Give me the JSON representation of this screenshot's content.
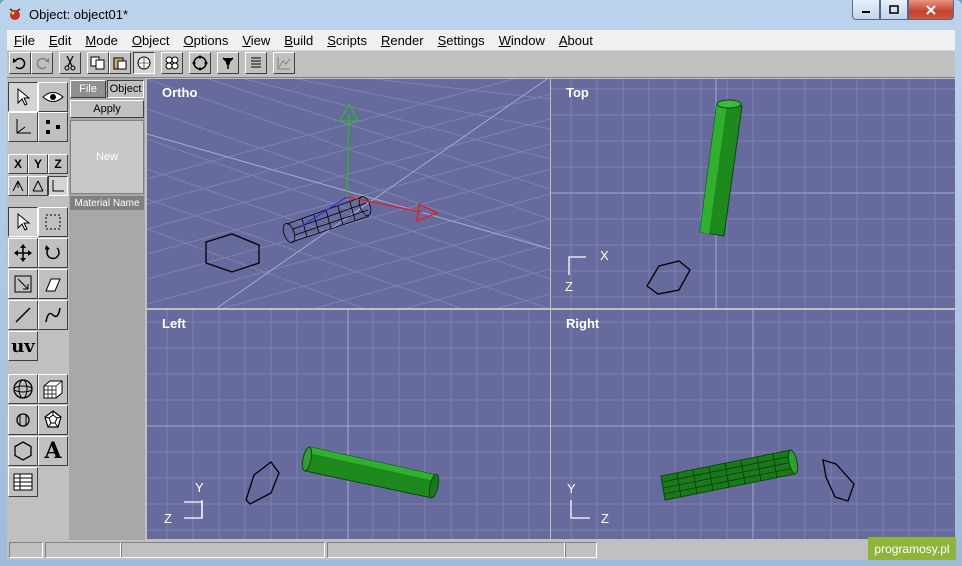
{
  "window": {
    "title": "Object: object01*"
  },
  "menu": [
    {
      "pre": "",
      "ul": "F",
      "post": "ile"
    },
    {
      "pre": "",
      "ul": "E",
      "post": "dit"
    },
    {
      "pre": "",
      "ul": "M",
      "post": "ode"
    },
    {
      "pre": "",
      "ul": "O",
      "post": "bject"
    },
    {
      "pre": "",
      "ul": "O",
      "post": "ptions"
    },
    {
      "pre": "",
      "ul": "V",
      "post": "iew"
    },
    {
      "pre": "",
      "ul": "B",
      "post": "uild"
    },
    {
      "pre": "",
      "ul": "S",
      "post": "cripts"
    },
    {
      "pre": "",
      "ul": "R",
      "post": "ender"
    },
    {
      "pre": "",
      "ul": "S",
      "post": "ettings"
    },
    {
      "pre": "",
      "ul": "W",
      "post": "indow"
    },
    {
      "pre": "",
      "ul": "A",
      "post": "bout"
    }
  ],
  "material": {
    "tab_file": "File",
    "tab_object": "Object",
    "apply": "Apply",
    "new": "New",
    "name_label": "Material Name"
  },
  "tools": {
    "axis_x": "X",
    "axis_y": "Y",
    "axis_z": "Z",
    "uv": "uv",
    "text_tool": "A"
  },
  "viewports": {
    "ortho": "Ortho",
    "top": "Top",
    "left": "Left",
    "right": "Right",
    "top_axis_h": "X",
    "top_axis_v": "Z",
    "left_axis_h": "Z",
    "left_axis_v": "Y",
    "right_axis_h": "Z",
    "right_axis_v": "Y"
  },
  "watermark": "programosy.pl",
  "colors": {
    "viewport_bg": "#666a9c",
    "grid": "#7e82b0",
    "object_green": "#1e8a1e",
    "axis_red": "#e02020",
    "axis_green": "#20c020",
    "axis_blue": "#3030e0"
  }
}
